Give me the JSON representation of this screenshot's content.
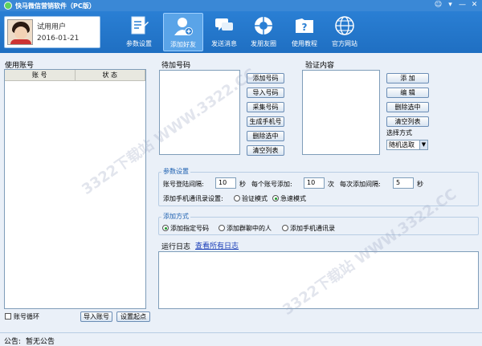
{
  "window": {
    "title": "快马微信营销软件（PC版）",
    "controls": [
      "☺",
      "▾",
      "—",
      "✕"
    ]
  },
  "user": {
    "name": "试用用户",
    "date": "2016-01-21"
  },
  "toolbar": {
    "items": [
      {
        "label": "参数设置",
        "icon": "settings-doc-icon",
        "active": false
      },
      {
        "label": "添加好友",
        "icon": "add-friend-icon",
        "active": true
      },
      {
        "label": "发送消息",
        "icon": "message-icon",
        "active": false
      },
      {
        "label": "发朋友圈",
        "icon": "moments-icon",
        "active": false
      },
      {
        "label": "使用教程",
        "icon": "tutorial-icon",
        "active": false
      },
      {
        "label": "官方网站",
        "icon": "globe-icon",
        "active": false
      }
    ]
  },
  "accounts": {
    "title": "使用账号",
    "columns": [
      "账  号",
      "状  态"
    ],
    "loop_label": "账号循环",
    "import_button": "导入账号",
    "start_button": "设置起点"
  },
  "pending": {
    "title": "待加号码",
    "buttons": [
      "添加号码",
      "导入号码",
      "采集号码",
      "生成手机号",
      "删除选中",
      "清空列表"
    ]
  },
  "verify": {
    "title": "验证内容",
    "buttons": [
      "添  加",
      "编  辑",
      "删除选中",
      "清空列表"
    ],
    "select_label": "选择方式",
    "select_value": "随机选取"
  },
  "params": {
    "title": "参数设置",
    "login_interval_label": "账号登陆间隔:",
    "login_interval_value": "10",
    "unit_sec": "秒",
    "per_account_label": "每个账号添加:",
    "per_account_value": "10",
    "unit_times": "次",
    "add_interval_label": "每次添加间隔:",
    "add_interval_value": "5",
    "unit_sec2": "秒",
    "contacts_mode_label": "添加手机通讯录设置:",
    "mode_verify": "验证模式",
    "mode_fast": "急速模式"
  },
  "method": {
    "title": "添加方式",
    "options": [
      "添加指定号码",
      "添加群聊中的人",
      "添加手机通讯录"
    ],
    "selected": 0
  },
  "log": {
    "title": "运行日志",
    "view_all": "查看所有日志"
  },
  "status": {
    "notice_label": "公告:",
    "notice_text": "暂无公告"
  },
  "watermark": "3322下载站  WWW.3322.CC"
}
